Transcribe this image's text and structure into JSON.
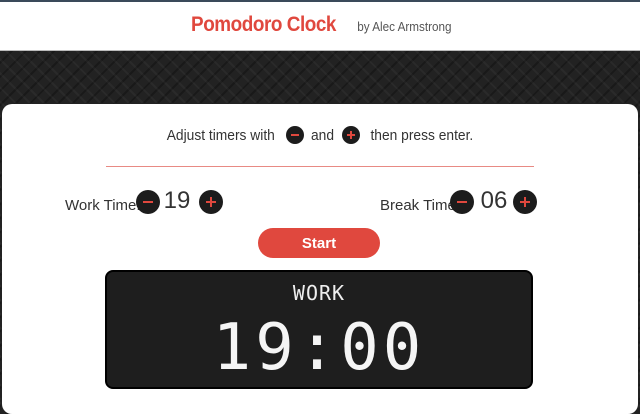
{
  "header": {
    "title": "Pomodoro Clock",
    "byline": "by Alec Armstrong"
  },
  "instructions": {
    "part1": "Adjust timers with",
    "part2": "and",
    "part3": "then press enter.",
    "minus_icon": "minus-icon",
    "plus_icon": "plus-icon"
  },
  "work": {
    "label": "Work Time:",
    "value": "19"
  },
  "break": {
    "label": "Break Time:",
    "value": "06"
  },
  "start_label": "Start",
  "display": {
    "mode": "WORK",
    "time": "19:00"
  },
  "colors": {
    "accent": "#e0483e",
    "dark": "#1c1c1c",
    "background": "#222222"
  }
}
